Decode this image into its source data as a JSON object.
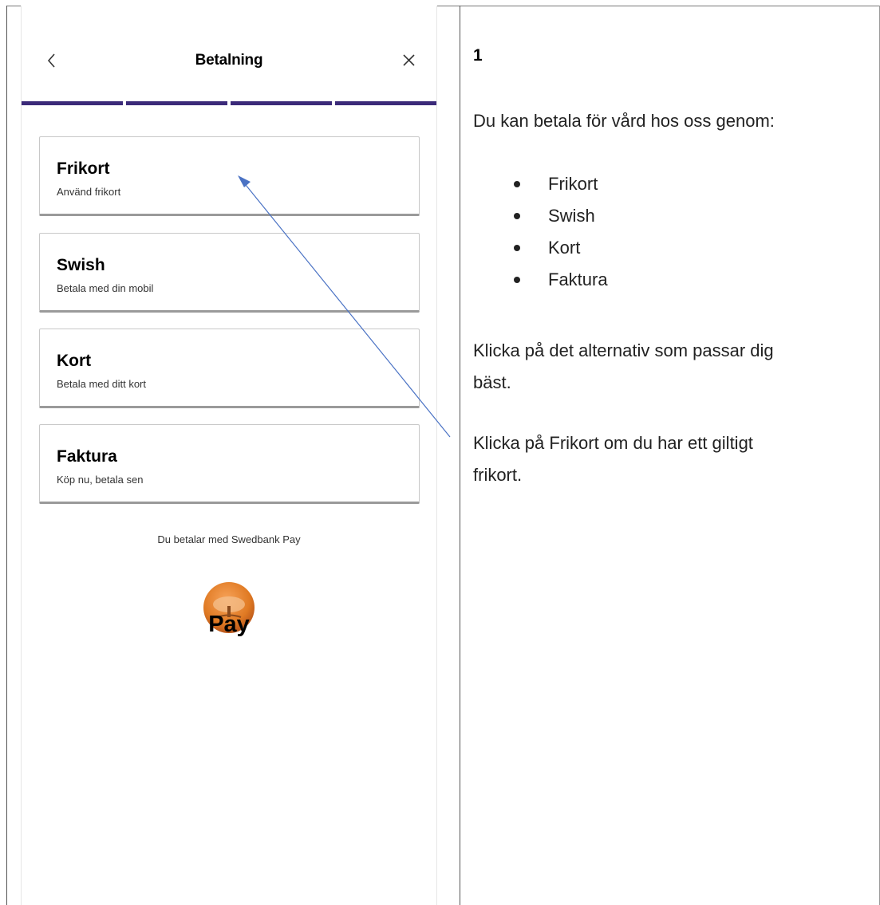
{
  "phone": {
    "title": "Betalning",
    "back_icon": "chevron-left-icon",
    "close_icon": "close-icon",
    "progress_steps": 4,
    "options": [
      {
        "title": "Frikort",
        "subtitle": "Använd frikort"
      },
      {
        "title": "Swish",
        "subtitle": "Betala med din mobil"
      },
      {
        "title": "Kort",
        "subtitle": "Betala med ditt kort"
      },
      {
        "title": "Faktura",
        "subtitle": "Köp nu, betala sen"
      }
    ],
    "provider_note": "Du betalar med Swedbank Pay",
    "logo_text": "Pay",
    "accent_color": "#3b2a79"
  },
  "instructions": {
    "step_number": "1",
    "intro": "Du kan betala för vård hos oss genom:",
    "methods": [
      "Frikort",
      "Swish",
      "Kort",
      "Faktura"
    ],
    "choose_line_1": "Klicka på det alternativ som passar dig",
    "choose_line_2": "bäst.",
    "frikort_line_1": "Klicka på Frikort om du har ett giltigt",
    "frikort_line_2": "frikort."
  }
}
